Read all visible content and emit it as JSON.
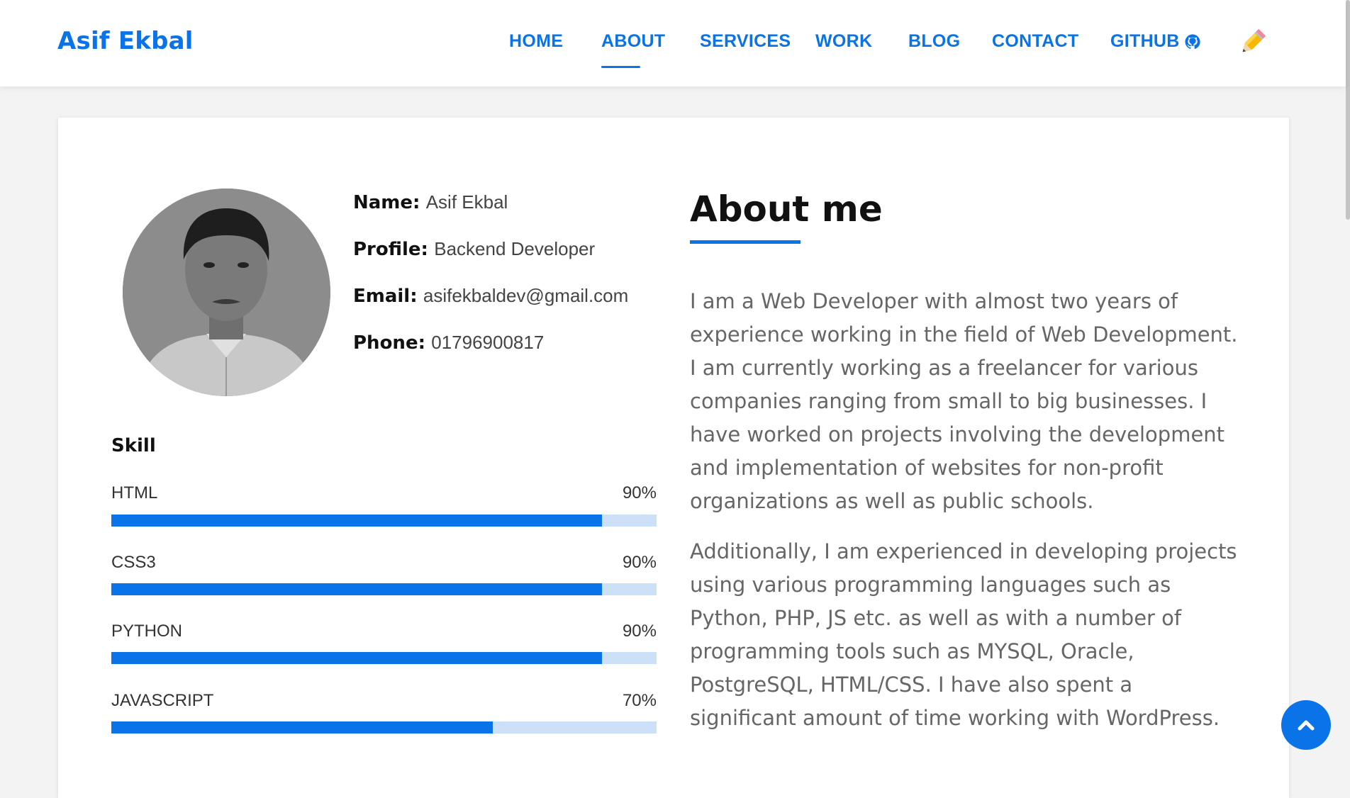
{
  "brand": "Asif Ekbal",
  "nav": {
    "home": "HOME",
    "about": "ABOUT",
    "services": "SERVICES",
    "work": "WORK",
    "blog": "BLOG",
    "contact": "CONTACT",
    "github": "GITHUB"
  },
  "icons": {
    "theme": "pencil-icon",
    "github": "github-icon",
    "scroll_top": "chevron-up-icon"
  },
  "colors": {
    "accent": "#0a73e8",
    "bar_track": "#cce0f8"
  },
  "profile": {
    "name_label": "Name:",
    "name": "Asif Ekbal",
    "profile_label": "Profile:",
    "profile": "Backend Developer",
    "email_label": "Email:",
    "email": "asifekbaldev@gmail.com",
    "phone_label": "Phone:",
    "phone": "01796900817"
  },
  "skills": {
    "title": "Skill",
    "items": [
      {
        "name": "HTML",
        "pct_label": "90%",
        "level": 90
      },
      {
        "name": "CSS3",
        "pct_label": "90%",
        "level": 90
      },
      {
        "name": "PYTHON",
        "pct_label": "90%",
        "level": 90
      },
      {
        "name": "JAVASCRIPT",
        "pct_label": "70%",
        "level": 70
      }
    ]
  },
  "about": {
    "title": "About me",
    "para1": "I am a Web Developer with almost two years of experience working in the field of Web Development. I am currently working as a freelancer for various companies ranging from small to big businesses. I have worked on projects involving the development and implementation of websites for non-profit organizations as well as public schools.",
    "para2": "Additionally, I am experienced in developing projects using various programming languages such as Python, PHP, JS etc. as well as with a number of programming tools such as MYSQL, Oracle, PostgreSQL, HTML/CSS. I have also spent a significant amount of time working with WordPress."
  }
}
